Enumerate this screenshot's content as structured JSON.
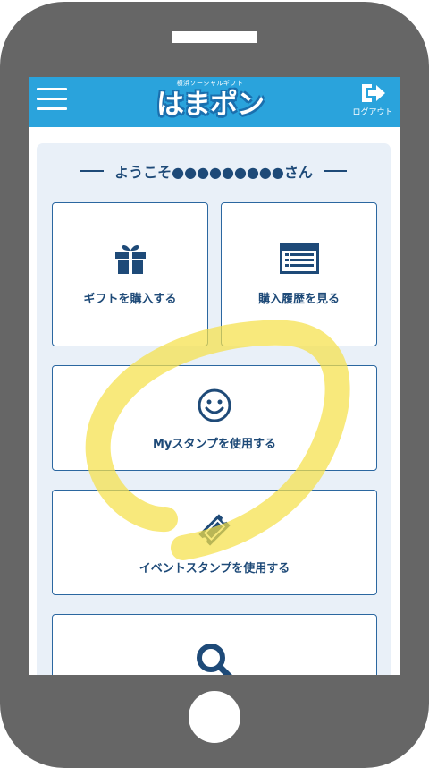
{
  "header": {
    "logo_subtitle": "横浜ソーシャルギフト",
    "logo_title": "はまポン",
    "logout_label": "ログアウト"
  },
  "welcome": {
    "text": "ようこそ●●●●●●●●●さん"
  },
  "menu": {
    "gift": {
      "label": "ギフトを購入する",
      "icon": "gift-icon"
    },
    "history": {
      "label": "購入履歴を見る",
      "icon": "list-icon"
    },
    "my_stamp": {
      "label": "Myスタンプを使用する",
      "icon": "smiley-icon"
    },
    "event_stamp": {
      "label": "イベントスタンプを使用する",
      "icon": "ticket-icon"
    },
    "search": {
      "icon": "search-icon"
    }
  },
  "colors": {
    "header_bg": "#2aa3dc",
    "accent": "#1e4a78",
    "content_bg": "#e9f0f8",
    "phone_body": "#666666",
    "highlight": "#f5e04a"
  }
}
